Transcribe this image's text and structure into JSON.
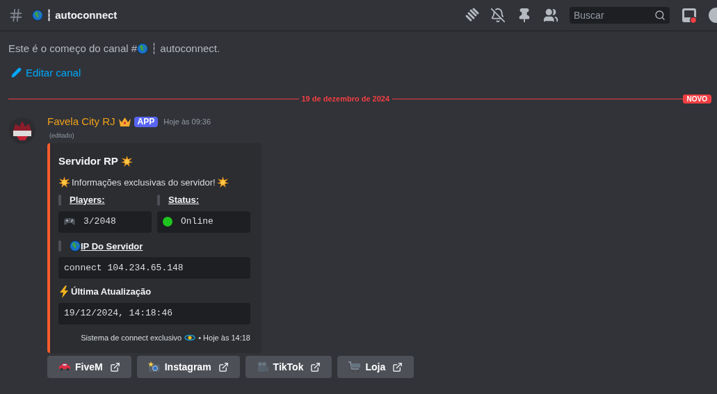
{
  "header": {
    "channel": "┆ autoconnect",
    "search": {
      "placeholder": "Buscar"
    }
  },
  "intro": {
    "before": "Este é o começo do canal #",
    "after": "┆ autoconnect.",
    "edit_link": "Editar canal"
  },
  "divider": {
    "date": "19 de dezembro de 2024",
    "badge": "NOVO"
  },
  "message": {
    "author": "Favela City RJ",
    "badge": "APP",
    "time": "Hoje às 09:36",
    "edited": "(editado)",
    "embed": {
      "title": "Servidor RP",
      "description": "Informações exclusivas do servidor!",
      "fields": [
        {
          "name": "Players:",
          "value": "3/2048",
          "kind": "players"
        },
        {
          "name": "Status:",
          "value": "Online",
          "kind": "status",
          "color": "#1ec51e"
        }
      ],
      "ip": {
        "name": "IP Do Servidor",
        "value": "connect 104.234.65.148"
      },
      "update": {
        "name": "Última Atualização",
        "value": "19/12/2024, 14:18:46"
      },
      "footer": {
        "text": "Sistema de connect exclusivo",
        "time": "• Hoje às 14:18"
      }
    },
    "buttons": [
      {
        "label": "FiveM"
      },
      {
        "label": "Instagram"
      },
      {
        "label": "TikTok"
      },
      {
        "label": "Loja"
      }
    ]
  }
}
